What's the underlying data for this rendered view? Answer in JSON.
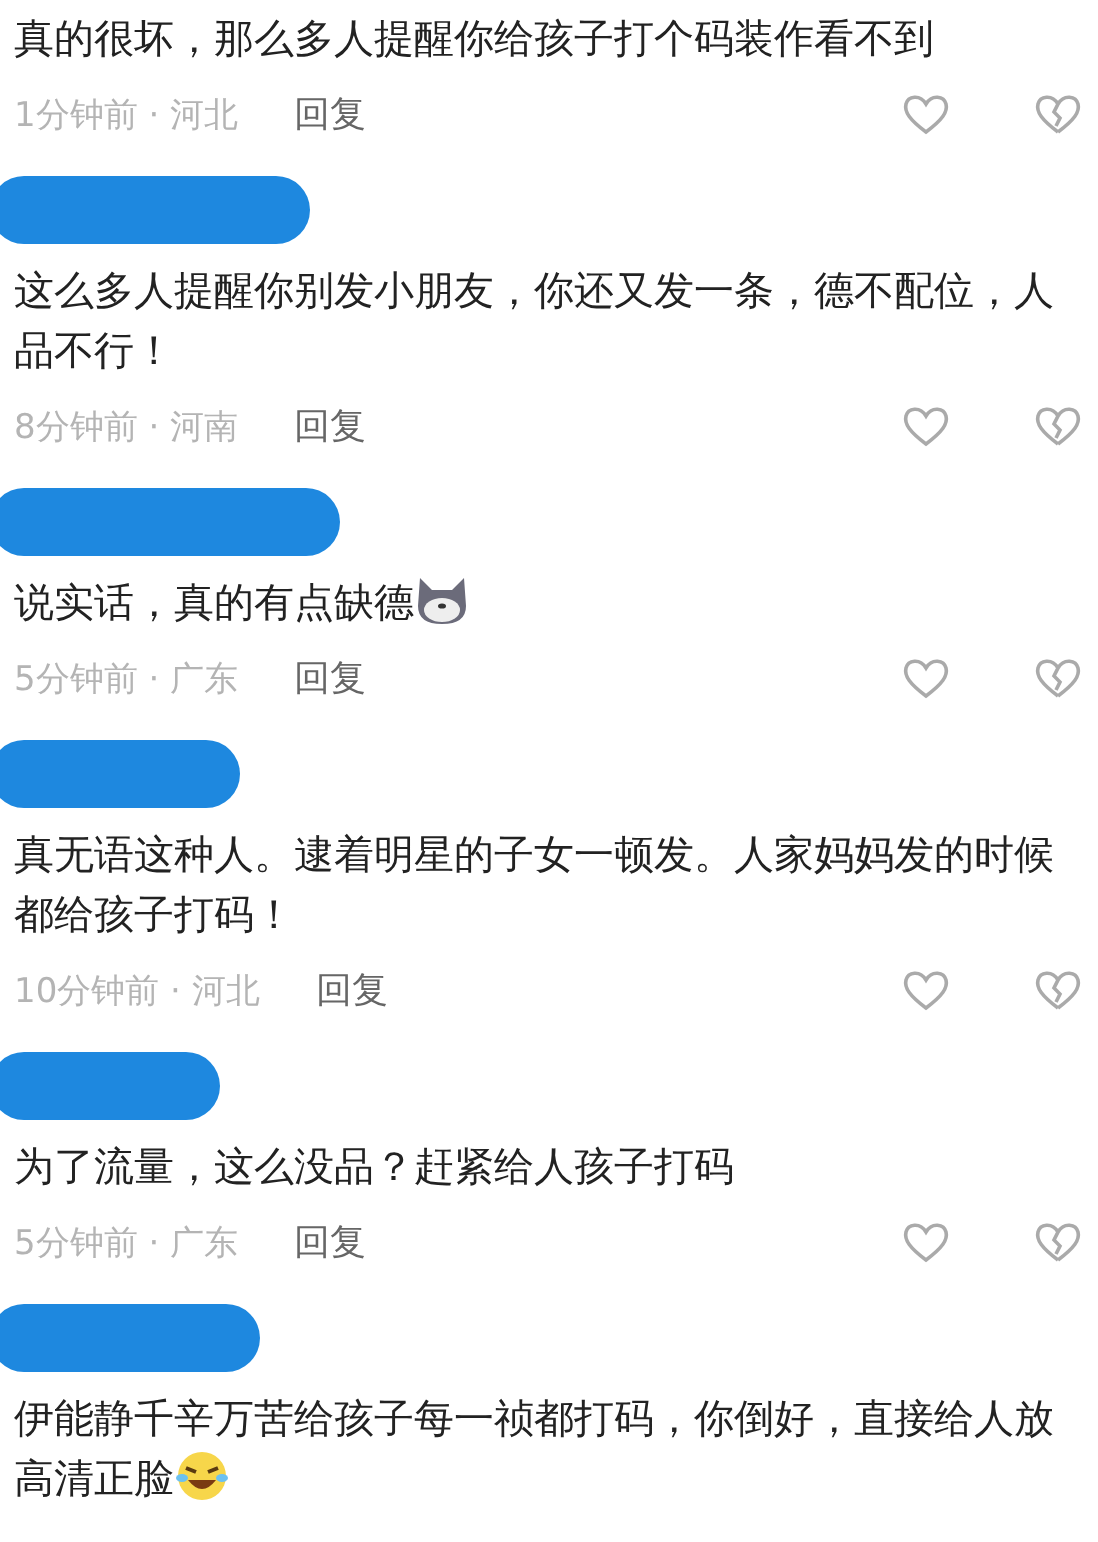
{
  "comments": [
    {
      "author_redacted": false,
      "kind": "plain",
      "text": "真的很坏，那么多人提醒你给孩子打个码装作看不到",
      "meta": "1分钟前 · 河北",
      "reply": "回复"
    },
    {
      "author_redacted": true,
      "kind": "plain",
      "text": "这么多人提醒你别发小朋友，你还又发一条，德不配位，人品不行！",
      "meta": "8分钟前 · 河南",
      "reply": "回复"
    },
    {
      "author_redacted": true,
      "kind": "dog",
      "text": "说实话，真的有点缺德",
      "meta": "5分钟前 · 广东",
      "reply": "回复"
    },
    {
      "author_redacted": true,
      "kind": "plain",
      "text": "真无语这种人。逮着明星的子女一顿发。人家妈妈发的时候都给孩子打码！",
      "meta": "10分钟前 · 河北",
      "reply": "回复"
    },
    {
      "author_redacted": true,
      "kind": "plain",
      "text": "为了流量，这么没品？赶紧给人孩子打码",
      "meta": "5分钟前 · 广东",
      "reply": "回复"
    },
    {
      "author_redacted": true,
      "kind": "laugh",
      "text": "伊能静千辛万苦给孩子每一祯都打码，你倒好，直接给人放高清正脸"
    }
  ]
}
